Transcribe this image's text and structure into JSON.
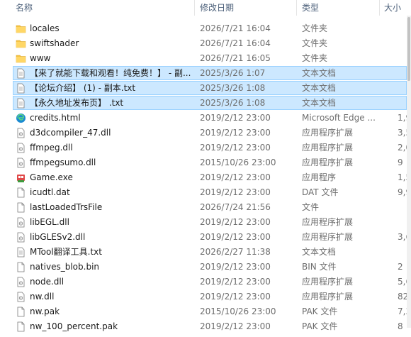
{
  "columns": {
    "name": "名称",
    "modified": "修改日期",
    "type": "类型",
    "size": "大小"
  },
  "files": [
    {
      "icon": "folder-icon",
      "name": "locales",
      "date": "2026/7/21 16:04",
      "type": "文件夹",
      "size": "",
      "selected": false
    },
    {
      "icon": "folder-icon",
      "name": "swiftshader",
      "date": "2026/7/21 16:04",
      "type": "文件夹",
      "size": "",
      "selected": false
    },
    {
      "icon": "folder-icon",
      "name": "www",
      "date": "2026/7/21 16:05",
      "type": "文件夹",
      "size": "",
      "selected": false
    },
    {
      "icon": "text-file-icon",
      "name": "【来了就能下载和观看！纯免费！】 - 副...",
      "date": "2025/3/26 1:07",
      "type": "文本文档",
      "size": "",
      "selected": true
    },
    {
      "icon": "text-file-icon",
      "name": "【论坛介绍】 (1) - 副本.txt",
      "date": "2025/3/26 1:08",
      "type": "文本文档",
      "size": "",
      "selected": true
    },
    {
      "icon": "text-file-icon",
      "name": "【永久地址发布页】 .txt",
      "date": "2025/3/26 1:08",
      "type": "文本文档",
      "size": "",
      "selected": true
    },
    {
      "icon": "edge-html-icon",
      "name": "credits.html",
      "date": "2019/2/12 23:00",
      "type": "Microsoft Edge ...",
      "size": "1,9",
      "selected": false
    },
    {
      "icon": "dll-file-icon",
      "name": "d3dcompiler_47.dll",
      "date": "2019/2/12 23:00",
      "type": "应用程序扩展",
      "size": "3,5",
      "selected": false
    },
    {
      "icon": "dll-file-icon",
      "name": "ffmpeg.dll",
      "date": "2019/2/12 23:00",
      "type": "应用程序扩展",
      "size": "2,0",
      "selected": false
    },
    {
      "icon": "dll-file-icon",
      "name": "ffmpegsumo.dll",
      "date": "2015/10/26 23:00",
      "type": "应用程序扩展",
      "size": "9",
      "selected": false
    },
    {
      "icon": "game-exe-icon",
      "name": "Game.exe",
      "date": "2019/2/12 23:00",
      "type": "应用程序",
      "size": "1,5",
      "selected": false
    },
    {
      "icon": "generic-file-icon",
      "name": "icudtl.dat",
      "date": "2019/2/12 23:00",
      "type": "DAT 文件",
      "size": "9,9",
      "selected": false
    },
    {
      "icon": "generic-file-icon",
      "name": "lastLoadedTrsFile",
      "date": "2026/7/24 21:56",
      "type": "文件",
      "size": "",
      "selected": false
    },
    {
      "icon": "dll-file-icon",
      "name": "libEGL.dll",
      "date": "2019/2/12 23:00",
      "type": "应用程序扩展",
      "size": "",
      "selected": false
    },
    {
      "icon": "dll-file-icon",
      "name": "libGLESv2.dll",
      "date": "2019/2/12 23:00",
      "type": "应用程序扩展",
      "size": "3,6",
      "selected": false
    },
    {
      "icon": "text-file-icon",
      "name": "MTool翻译工具.txt",
      "date": "2026/2/27 11:38",
      "type": "文本文档",
      "size": "",
      "selected": false
    },
    {
      "icon": "generic-file-icon",
      "name": "natives_blob.bin",
      "date": "2019/2/12 23:00",
      "type": "BIN 文件",
      "size": "2",
      "selected": false
    },
    {
      "icon": "dll-file-icon",
      "name": "node.dll",
      "date": "2019/2/12 23:00",
      "type": "应用程序扩展",
      "size": "5,6",
      "selected": false
    },
    {
      "icon": "dll-file-icon",
      "name": "nw.dll",
      "date": "2019/2/12 23:00",
      "type": "应用程序扩展",
      "size": "82,4",
      "selected": false
    },
    {
      "icon": "generic-file-icon",
      "name": "nw.pak",
      "date": "2015/10/26 23:00",
      "type": "PAK 文件",
      "size": "7,3",
      "selected": false
    },
    {
      "icon": "generic-file-icon",
      "name": "nw_100_percent.pak",
      "date": "2019/2/12 23:00",
      "type": "PAK 文件",
      "size": "8",
      "selected": false
    }
  ],
  "colors": {
    "selection": "#cce8ff",
    "selection_border": "#99d1ff",
    "folder": "#f6c343",
    "edge": "#1b8ad1"
  }
}
